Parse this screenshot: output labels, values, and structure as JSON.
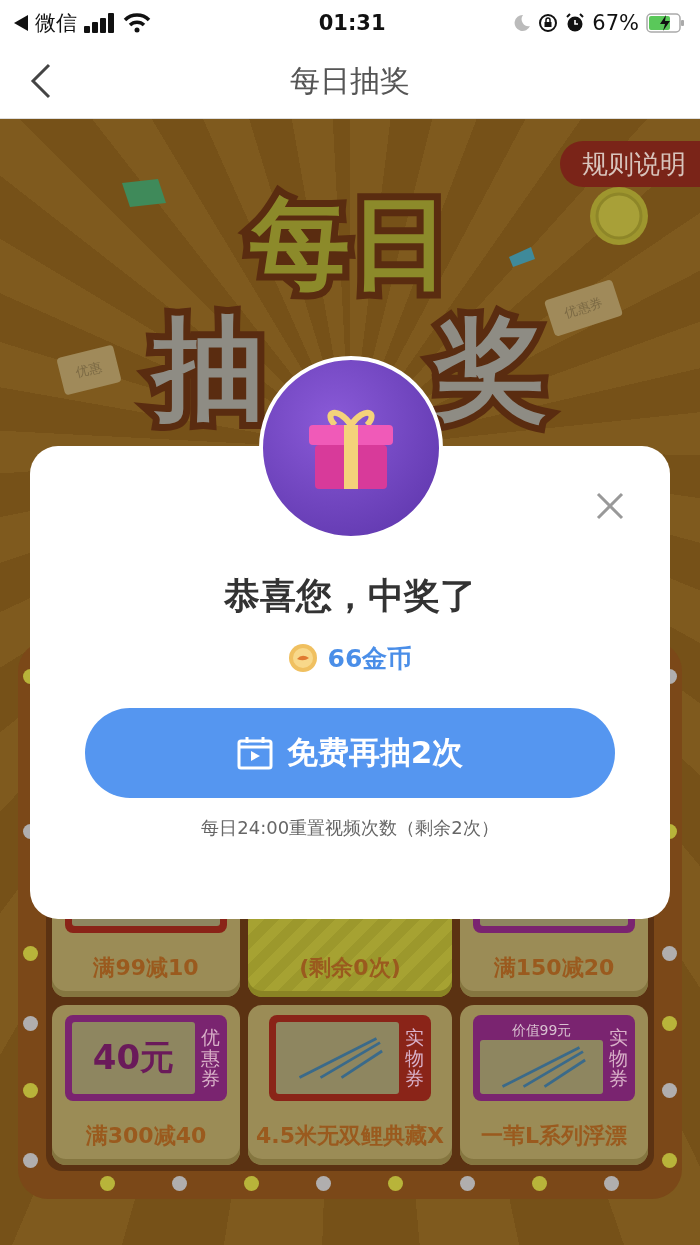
{
  "status_bar": {
    "carrier": "微信",
    "time": "01:31",
    "battery": "67%"
  },
  "nav": {
    "title": "每日抽奖"
  },
  "banner": {
    "rules_button": "规则说明",
    "title_top": "每日",
    "title_bottom_parts": [
      "抽",
      "奖"
    ],
    "vouchers": [
      "优惠",
      "优惠券"
    ]
  },
  "board": {
    "rows": [
      [
        {
          "kind": "coupon",
          "label": "满99减10",
          "color": "#8a2418"
        },
        {
          "kind": "draw",
          "label": "(剩余0次)"
        },
        {
          "kind": "coupon",
          "label": "满150减20",
          "color": "#7a2470"
        }
      ],
      [
        {
          "kind": "coupon",
          "label": "满300减40",
          "value": "40元",
          "tag": "优惠券",
          "color": "#7a2470"
        },
        {
          "kind": "product",
          "label": "4.5米无双鲤典藏X",
          "tag": "实物券",
          "color": "#8a2418"
        },
        {
          "kind": "product",
          "label": "一苇L系列浮漂",
          "price": "价值99元",
          "tag": "实物券",
          "color": "#7a2470"
        }
      ]
    ]
  },
  "dialog": {
    "title": "恭喜您，中奖了",
    "reward": "66金币",
    "button": "免费再抽2次",
    "note": "每日24:00重置视频次数（剩余2次）"
  }
}
